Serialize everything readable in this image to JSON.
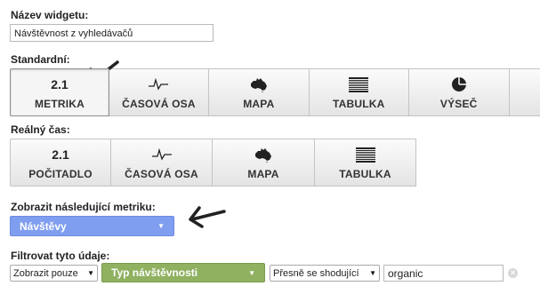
{
  "widget_name": {
    "label": "Název widgetu:",
    "value": "Návštěvnost z vyhledávačů"
  },
  "standard": {
    "label": "Standardní:",
    "buttons": [
      {
        "icon_text": "2.1",
        "icon": "number-icon",
        "label": "METRIKA",
        "active": true
      },
      {
        "icon": "timeline-icon",
        "label": "ČASOVÁ OSA"
      },
      {
        "icon": "map-icon",
        "label": "MAPA"
      },
      {
        "icon": "table-icon",
        "label": "TABULKA"
      },
      {
        "icon": "pie-icon",
        "label": "VÝSEČ"
      }
    ]
  },
  "realtime": {
    "label": "Reálný čas:",
    "buttons": [
      {
        "icon_text": "2.1",
        "icon": "number-icon",
        "label": "POČITADLO"
      },
      {
        "icon": "timeline-icon",
        "label": "ČASOVÁ OSA"
      },
      {
        "icon": "map-icon",
        "label": "MAPA"
      },
      {
        "icon": "table-icon",
        "label": "TABULKA"
      }
    ]
  },
  "metric": {
    "label": "Zobrazit následující metriku:",
    "value": "Návštěvy",
    "color": "#7f9ef0"
  },
  "filter": {
    "label": "Filtrovat tyto údaje:",
    "mode": "Zobrazit pouze",
    "dimension": "Typ návštěvnosti",
    "dimension_color": "#8fb160",
    "match": "Přesně se shodující",
    "value": "organic",
    "clear_icon": "clear-icon"
  }
}
